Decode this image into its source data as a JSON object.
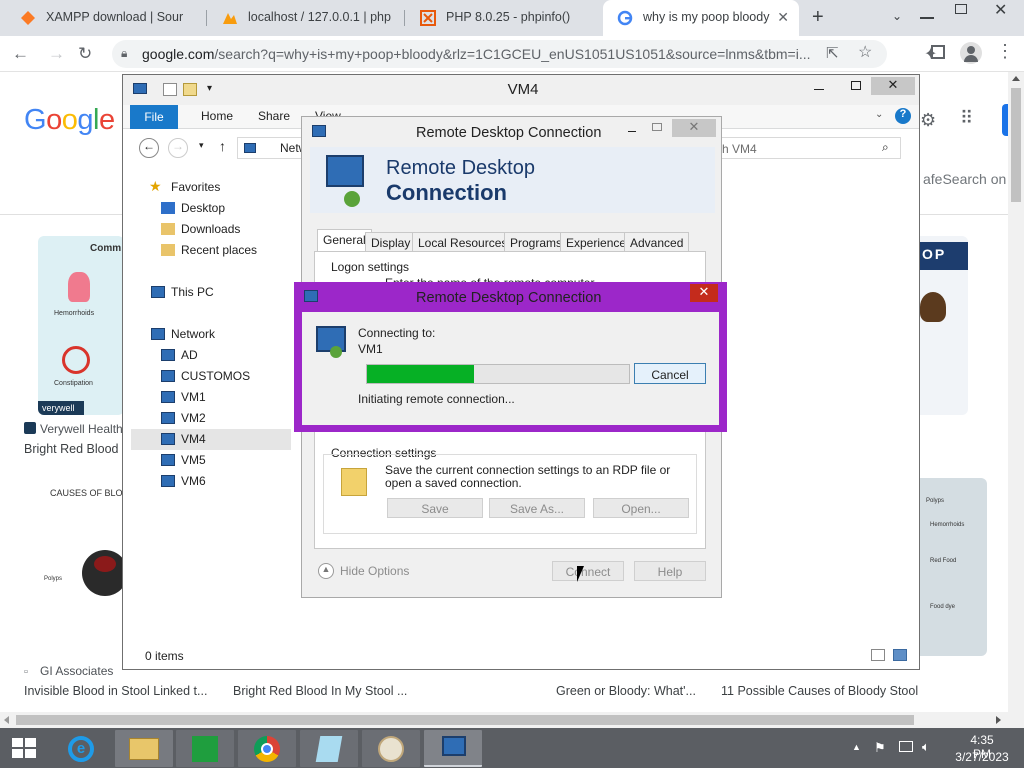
{
  "browser": {
    "tabs": [
      {
        "label": "XAMPP download | Sour"
      },
      {
        "label": "localhost / 127.0.0.1 | php"
      },
      {
        "label": "PHP 8.0.25 - phpinfo()"
      },
      {
        "label": "why is my poop bloody"
      }
    ],
    "url_host": "google.com",
    "url_rest": "/search?q=why+is+my+poop+bloody&rlz=1C1GCEU_enUS1051US1051&source=lnms&tbm=i...",
    "safesearch": "afeSearch on"
  },
  "results": [
    {
      "source": "Verywell Health",
      "title": "Bright Red Blood i"
    },
    {
      "source": "GI Associates",
      "title": "Invisible Blood in Stool Linked t..."
    },
    {
      "title": "Bright Red Blood In My Stool ..."
    },
    {
      "title": "Green or Bloody: What'..."
    },
    {
      "title": "11 Possible Causes of Bloody Stool"
    }
  ],
  "thumbs": {
    "common_label": "Comm",
    "hemorrhoids": "Hemorrhoids",
    "constipation": "Constipation",
    "verywell": "verywell",
    "causes": "CAUSES OF BLO",
    "poop": "OP",
    "polyps": "Polyps",
    "hemorrhoids2": "Hemorrhoids",
    "food": "Food dye",
    "red_food": "Red Food"
  },
  "explorer": {
    "title": "VM4",
    "ribbon": {
      "file": "File",
      "home": "Home",
      "share": "Share",
      "view": "View"
    },
    "address": "Netw",
    "search_placeholder": "rch VM4",
    "status": "0 items",
    "nav": [
      {
        "label": "Favorites"
      },
      {
        "label": "Desktop"
      },
      {
        "label": "Downloads"
      },
      {
        "label": "Recent places"
      },
      {
        "label": "This PC"
      },
      {
        "label": "Network"
      },
      {
        "label": "AD"
      },
      {
        "label": "CUSTOMOS"
      },
      {
        "label": "VM1"
      },
      {
        "label": "VM2"
      },
      {
        "label": "VM4"
      },
      {
        "label": "VM5"
      },
      {
        "label": "VM6"
      }
    ]
  },
  "rdc": {
    "title": "Remote Desktop Connection",
    "banner_line1": "Remote Desktop",
    "banner_line2": "Connection",
    "tabs": [
      "General",
      "Display",
      "Local Resources",
      "Programs",
      "Experience",
      "Advanced"
    ],
    "logon_settings": "Logon settings",
    "logon_text": "Enter the name of the remote computer.",
    "connection_settings": "Connection settings",
    "conn_text": "Save the current connection settings to an RDP file or open a saved connection.",
    "save": "Save",
    "save_as": "Save As...",
    "open": "Open...",
    "hide_options": "Hide Options",
    "connect": "Connect",
    "help": "Help"
  },
  "progress": {
    "title": "Remote Desktop Connection",
    "connecting_to": "Connecting to:",
    "target": "VM1",
    "cancel": "Cancel",
    "status": "Initiating remote connection...",
    "percent": 41
  },
  "taskbar": {
    "time": "4:35 PM",
    "date": "3/27/2023"
  },
  "colors": {
    "progress_green": "#06b025",
    "dialog_purple": "#9c27c9",
    "taskbar": "#5b5e63"
  }
}
